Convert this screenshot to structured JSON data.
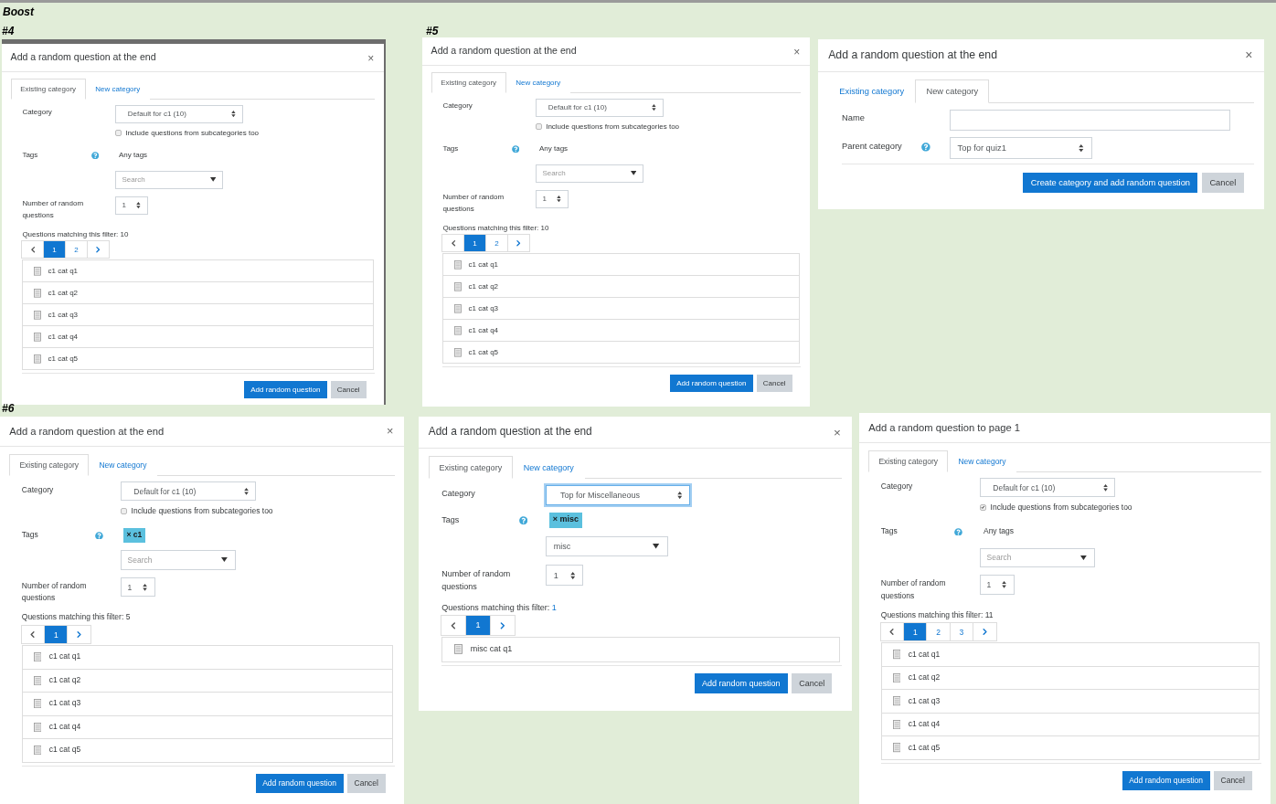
{
  "heading": "Boost",
  "dialogs": [
    {
      "label": "#4",
      "title": "Add a random question at the end",
      "close": "×",
      "tabs": [
        {
          "label": "Existing category",
          "selected": true
        },
        {
          "label": "New category",
          "selected": false
        }
      ],
      "form": {
        "kind": "existing",
        "category": {
          "label": "Category",
          "value": "Default for c1 (10)",
          "focused": false
        },
        "include": {
          "label": "Include questions from subcategories too",
          "checked": false
        },
        "tags": {
          "label": "Tags",
          "help": true,
          "any": "Any tags"
        },
        "search": {
          "placeholder": "Search"
        },
        "number": {
          "label": "Number of random questions",
          "value": "1"
        },
        "matching": {
          "text": "Questions matching this filter:",
          "count": "10",
          "linked": false
        },
        "pages": [
          {
            "label": "1",
            "selected": true
          },
          {
            "label": "2",
            "selected": false
          }
        ],
        "questions": [
          "c1 cat q1",
          "c1 cat q2",
          "c1 cat q3",
          "c1 cat q4",
          "c1 cat q5"
        ]
      },
      "buttons": [
        {
          "label": "Add random question",
          "kind": "primary"
        },
        {
          "label": "Cancel",
          "kind": "secondary"
        }
      ]
    },
    {
      "label": "#5",
      "title": "Add a random question at the end",
      "close": "×",
      "tabs": [
        {
          "label": "Existing category",
          "selected": true
        },
        {
          "label": "New category",
          "selected": false
        }
      ],
      "form": {
        "kind": "existing",
        "category": {
          "label": "Category",
          "value": "Default for c1 (10)",
          "focused": false
        },
        "include": {
          "label": "Include questions from subcategories too",
          "checked": false
        },
        "tags": {
          "label": "Tags",
          "help": true,
          "any": "Any tags"
        },
        "search": {
          "placeholder": "Search"
        },
        "number": {
          "label": "Number of random questions",
          "value": "1"
        },
        "matching": {
          "text": "Questions matching this filter:",
          "count": "10",
          "linked": false
        },
        "pages": [
          {
            "label": "1",
            "selected": true
          },
          {
            "label": "2",
            "selected": false
          }
        ],
        "questions": [
          "c1 cat q1",
          "c1 cat q2",
          "c1 cat q3",
          "c1 cat q4",
          "c1 cat q5"
        ]
      },
      "buttons": [
        {
          "label": "Add random question",
          "kind": "primary"
        },
        {
          "label": "Cancel",
          "kind": "secondary"
        }
      ]
    },
    {
      "title": "Add a random question at the end",
      "close": "×",
      "tabs": [
        {
          "label": "Existing category",
          "selected": false
        },
        {
          "label": "New category",
          "selected": true
        }
      ],
      "form": {
        "kind": "new",
        "name": {
          "label": "Name"
        },
        "parent": {
          "label": "Parent category",
          "help": true,
          "value": "Top for quiz1"
        }
      },
      "buttons": [
        {
          "label": "Create category and add random question",
          "kind": "primary"
        },
        {
          "label": "Cancel",
          "kind": "secondary"
        }
      ]
    },
    {
      "label": "#6",
      "title": "Add a random question at the end",
      "close": "×",
      "tabs": [
        {
          "label": "Existing category",
          "selected": true
        },
        {
          "label": "New category",
          "selected": false
        }
      ],
      "form": {
        "kind": "existing",
        "category": {
          "label": "Category",
          "value": "Default for c1 (10)",
          "focused": false
        },
        "include": {
          "label": "Include questions from subcategories too",
          "checked": false
        },
        "tags": {
          "label": "Tags",
          "help": true,
          "chips": [
            "× c1"
          ]
        },
        "search": {
          "placeholder": "Search"
        },
        "number": {
          "label": "Number of random questions",
          "value": "1"
        },
        "matching": {
          "text": "Questions matching this filter:",
          "count": "5",
          "linked": false
        },
        "pages": [
          {
            "label": "1",
            "selected": true
          }
        ],
        "questions": [
          "c1 cat q1",
          "c1 cat q2",
          "c1 cat q3",
          "c1 cat q4",
          "c1 cat q5"
        ]
      },
      "buttons": [
        {
          "label": "Add random question",
          "kind": "primary"
        },
        {
          "label": "Cancel",
          "kind": "secondary"
        }
      ]
    },
    {
      "title": "Add a random question at the end",
      "close": "×",
      "tabs": [
        {
          "label": "Existing category",
          "selected": true
        },
        {
          "label": "New category",
          "selected": false
        }
      ],
      "form": {
        "kind": "existing",
        "category": {
          "label": "Category",
          "value": "Top for Miscellaneous",
          "focused": true
        },
        "tags": {
          "label": "Tags",
          "help": true,
          "chips": [
            "× misc"
          ]
        },
        "search": {
          "value": "misc"
        },
        "number": {
          "label": "Number of random questions",
          "value": "1"
        },
        "matching": {
          "text": "Questions matching this filter:",
          "count": "1",
          "linked": true
        },
        "pages": [
          {
            "label": "1",
            "selected": true
          }
        ],
        "questions": [
          "misc cat q1"
        ]
      },
      "buttons": [
        {
          "label": "Add random question",
          "kind": "primary"
        },
        {
          "label": "Cancel",
          "kind": "secondary"
        }
      ]
    },
    {
      "title": "Add a random question to page 1",
      "tabs": [
        {
          "label": "Existing category",
          "selected": true
        },
        {
          "label": "New category",
          "selected": false
        }
      ],
      "form": {
        "kind": "existing",
        "category": {
          "label": "Category",
          "value": "Default for c1 (10)",
          "focused": false
        },
        "include": {
          "label": "Include questions from subcategories too",
          "checked": true
        },
        "tags": {
          "label": "Tags",
          "help": true,
          "any": "Any tags"
        },
        "search": {
          "placeholder": "Search"
        },
        "number": {
          "label": "Number of random questions",
          "value": "1"
        },
        "matching": {
          "text": "Questions matching this filter:",
          "count": "11",
          "linked": false
        },
        "pages": [
          {
            "label": "1",
            "selected": true
          },
          {
            "label": "2",
            "selected": false
          },
          {
            "label": "3",
            "selected": false
          }
        ],
        "questions": [
          "c1 cat q1",
          "c1 cat q2",
          "c1 cat q3",
          "c1 cat q4",
          "c1 cat q5"
        ]
      },
      "buttons": [
        {
          "label": "Add random question",
          "kind": "primary"
        },
        {
          "label": "Cancel",
          "kind": "secondary"
        }
      ]
    }
  ]
}
